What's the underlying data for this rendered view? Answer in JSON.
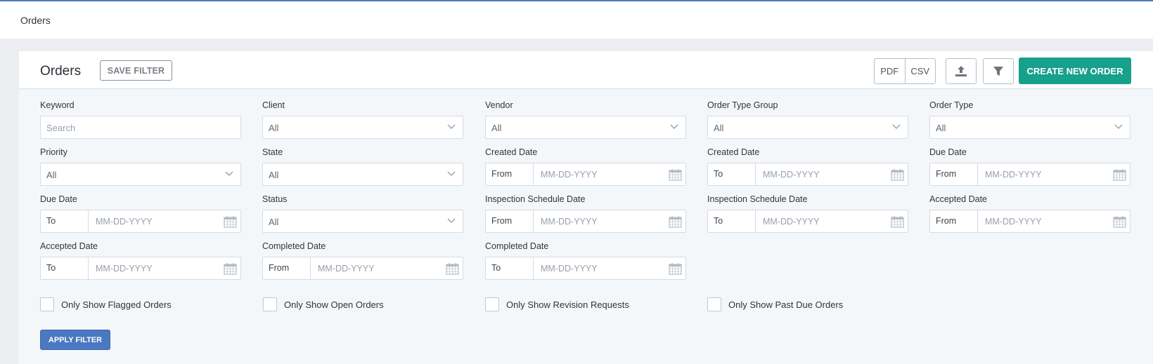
{
  "breadcrumb": "Orders",
  "panel": {
    "title": "Orders",
    "save_filter": "SAVE FILTER",
    "export_pdf": "PDF",
    "export_csv": "CSV",
    "create_new": "CREATE NEW ORDER"
  },
  "filters": {
    "keyword": {
      "label": "Keyword",
      "placeholder": "Search"
    },
    "client": {
      "label": "Client",
      "value": "All"
    },
    "vendor": {
      "label": "Vendor",
      "value": "All"
    },
    "order_type_group": {
      "label": "Order Type Group",
      "value": "All"
    },
    "order_type": {
      "label": "Order Type",
      "value": "All"
    },
    "priority": {
      "label": "Priority",
      "value": "All"
    },
    "state": {
      "label": "State",
      "value": "All"
    },
    "created_from": {
      "label": "Created Date",
      "prefix": "From",
      "placeholder": "MM-DD-YYYY"
    },
    "created_to": {
      "label": "Created Date",
      "prefix": "To",
      "placeholder": "MM-DD-YYYY"
    },
    "due_from": {
      "label": "Due Date",
      "prefix": "From",
      "placeholder": "MM-DD-YYYY"
    },
    "due_to": {
      "label": "Due Date",
      "prefix": "To",
      "placeholder": "MM-DD-YYYY"
    },
    "status": {
      "label": "Status",
      "value": "All"
    },
    "inspection_from": {
      "label": "Inspection Schedule Date",
      "prefix": "From",
      "placeholder": "MM-DD-YYYY"
    },
    "inspection_to": {
      "label": "Inspection Schedule Date",
      "prefix": "To",
      "placeholder": "MM-DD-YYYY"
    },
    "accepted_from": {
      "label": "Accepted Date",
      "prefix": "From",
      "placeholder": "MM-DD-YYYY"
    },
    "accepted_to": {
      "label": "Accepted Date",
      "prefix": "To",
      "placeholder": "MM-DD-YYYY"
    },
    "completed_from": {
      "label": "Completed Date",
      "prefix": "From",
      "placeholder": "MM-DD-YYYY"
    },
    "completed_to": {
      "label": "Completed Date",
      "prefix": "To",
      "placeholder": "MM-DD-YYYY"
    }
  },
  "checkboxes": {
    "flagged": "Only Show Flagged Orders",
    "open": "Only Show Open Orders",
    "revision": "Only Show Revision Requests",
    "past_due": "Only Show Past Due Orders"
  },
  "apply_filter": "APPLY FILTER",
  "colors": {
    "accent": "#4a78c2",
    "create": "#17a08c"
  },
  "icons": [
    "upload-icon",
    "filter-icon",
    "chevron-down-icon",
    "calendar-icon"
  ]
}
